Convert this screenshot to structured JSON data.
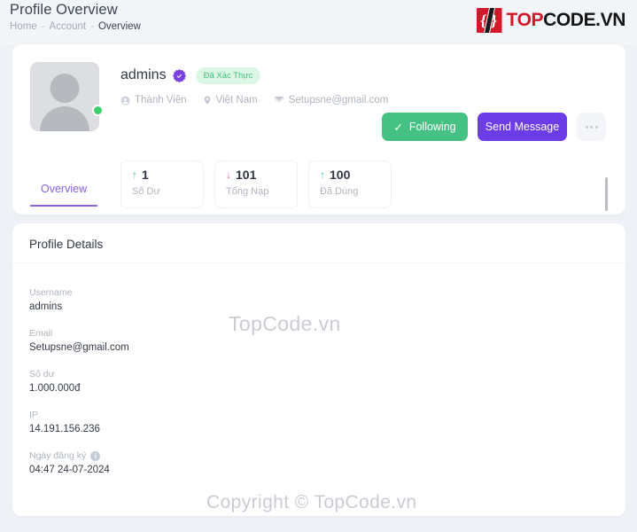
{
  "header": {
    "title": "Profile Overview",
    "breadcrumb": [
      {
        "label": "Home",
        "current": false
      },
      {
        "label": "Account",
        "current": false
      },
      {
        "label": "Overview",
        "current": true
      }
    ],
    "separator": "-"
  },
  "brand": {
    "mark_glyph": "{/}",
    "text_part1": "TOP",
    "text_part2": "CODE.VN",
    "color_red": "#d1192b",
    "color_dark": "#151515"
  },
  "profile": {
    "username": "admins",
    "verified_icon": "verified-badge-icon",
    "verified_badge_label": "Đã Xác Thực",
    "status": "online",
    "meta": [
      {
        "icon": "member-icon",
        "label": "Thành Viên"
      },
      {
        "icon": "location-pin-icon",
        "label": "Việt Nam"
      },
      {
        "icon": "envelope-icon",
        "label": "Setupsne@gmail.com"
      }
    ],
    "stats": [
      {
        "value": "1",
        "label": "Số Dư",
        "trend": "up"
      },
      {
        "value": "101",
        "label": "Tổng Nạp",
        "trend": "down"
      },
      {
        "value": "100",
        "label": "Đã Dùng",
        "trend": "up"
      }
    ],
    "actions": {
      "follow_label": "Following",
      "follow_icon": "check-icon",
      "follow_color": "#45c283",
      "message_label": "Send Message",
      "message_color": "#6c3ce9",
      "more_icon": "ellipsis-icon"
    },
    "tabs": [
      {
        "label": "Overview",
        "active": true
      }
    ],
    "tab_accent": "#8a62e0"
  },
  "details": {
    "title": "Profile Details",
    "fields": [
      {
        "label": "Username",
        "value": "admins",
        "info": false
      },
      {
        "label": "Email",
        "value": "Setupsne@gmail.com",
        "info": false
      },
      {
        "label": "Số dư",
        "value": "1.000.000đ",
        "info": false
      },
      {
        "label": "IP",
        "value": "14.191.156.236",
        "info": false
      },
      {
        "label": "Ngày đăng ký",
        "value": "04:47 24-07-2024",
        "info": true
      }
    ]
  },
  "watermarks": {
    "center": "TopCode.vn",
    "bottom": "Copyright © TopCode.vn"
  }
}
